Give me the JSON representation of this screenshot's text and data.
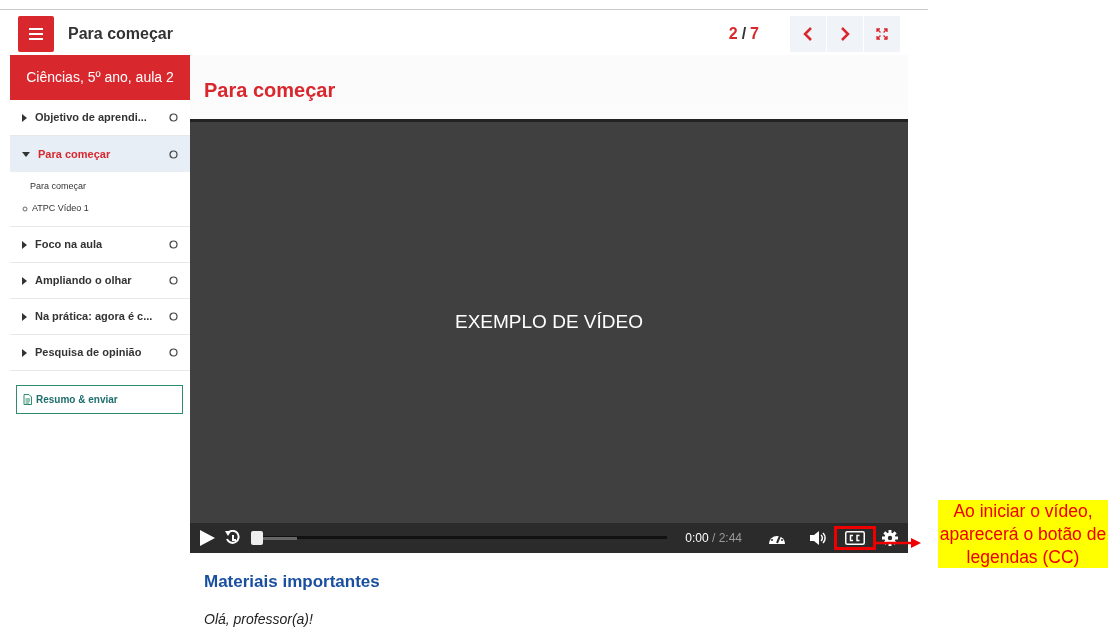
{
  "header": {
    "title": "Para começar",
    "page": "2",
    "separator": "/",
    "total": "7"
  },
  "sidebar": {
    "course": "Ciências, 5º ano, aula 2",
    "items": [
      {
        "label": "Objetivo de aprendi...",
        "expanded": false,
        "selected": false,
        "completed": false
      },
      {
        "label": "Para começar",
        "expanded": true,
        "selected": true,
        "completed": false,
        "children": [
          {
            "label": "Para começar",
            "kind": "plain"
          },
          {
            "label": "ATPC Vídeo 1",
            "kind": "bullet"
          }
        ]
      },
      {
        "label": "Foco na aula",
        "expanded": false,
        "selected": false,
        "completed": false
      },
      {
        "label": "Ampliando o olhar",
        "expanded": false,
        "selected": false,
        "completed": false
      },
      {
        "label": "Na prática: agora é c...",
        "expanded": false,
        "selected": false,
        "completed": false
      },
      {
        "label": "Pesquisa de opinião",
        "expanded": false,
        "selected": false,
        "completed": false
      }
    ],
    "submit": "Resumo & enviar"
  },
  "content": {
    "title": "Para começar",
    "video": {
      "caption": "EXEMPLO DE VÍDEO",
      "elapsed": "0:00",
      "duration": "/ 2:44",
      "progress": {
        "level": 0
      },
      "buffer": {
        "level": 0.11
      }
    },
    "section": "Materiais importantes",
    "greeting": "Olá, professor(a)!"
  },
  "annotation": {
    "text": "Ao iniciar o vídeo, aparecerá o botão de legendas (CC)"
  }
}
